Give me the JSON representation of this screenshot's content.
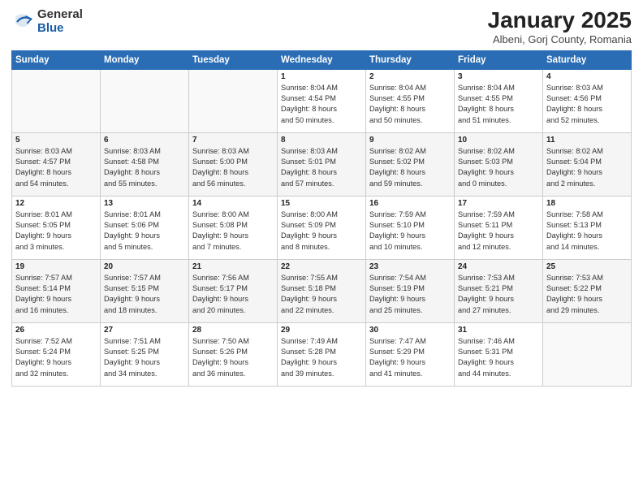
{
  "logo": {
    "general": "General",
    "blue": "Blue"
  },
  "header": {
    "month": "January 2025",
    "location": "Albeni, Gorj County, Romania"
  },
  "weekdays": [
    "Sunday",
    "Monday",
    "Tuesday",
    "Wednesday",
    "Thursday",
    "Friday",
    "Saturday"
  ],
  "weeks": [
    [
      {
        "day": "",
        "info": ""
      },
      {
        "day": "",
        "info": ""
      },
      {
        "day": "",
        "info": ""
      },
      {
        "day": "1",
        "info": "Sunrise: 8:04 AM\nSunset: 4:54 PM\nDaylight: 8 hours\nand 50 minutes."
      },
      {
        "day": "2",
        "info": "Sunrise: 8:04 AM\nSunset: 4:55 PM\nDaylight: 8 hours\nand 50 minutes."
      },
      {
        "day": "3",
        "info": "Sunrise: 8:04 AM\nSunset: 4:55 PM\nDaylight: 8 hours\nand 51 minutes."
      },
      {
        "day": "4",
        "info": "Sunrise: 8:03 AM\nSunset: 4:56 PM\nDaylight: 8 hours\nand 52 minutes."
      }
    ],
    [
      {
        "day": "5",
        "info": "Sunrise: 8:03 AM\nSunset: 4:57 PM\nDaylight: 8 hours\nand 54 minutes."
      },
      {
        "day": "6",
        "info": "Sunrise: 8:03 AM\nSunset: 4:58 PM\nDaylight: 8 hours\nand 55 minutes."
      },
      {
        "day": "7",
        "info": "Sunrise: 8:03 AM\nSunset: 5:00 PM\nDaylight: 8 hours\nand 56 minutes."
      },
      {
        "day": "8",
        "info": "Sunrise: 8:03 AM\nSunset: 5:01 PM\nDaylight: 8 hours\nand 57 minutes."
      },
      {
        "day": "9",
        "info": "Sunrise: 8:02 AM\nSunset: 5:02 PM\nDaylight: 8 hours\nand 59 minutes."
      },
      {
        "day": "10",
        "info": "Sunrise: 8:02 AM\nSunset: 5:03 PM\nDaylight: 9 hours\nand 0 minutes."
      },
      {
        "day": "11",
        "info": "Sunrise: 8:02 AM\nSunset: 5:04 PM\nDaylight: 9 hours\nand 2 minutes."
      }
    ],
    [
      {
        "day": "12",
        "info": "Sunrise: 8:01 AM\nSunset: 5:05 PM\nDaylight: 9 hours\nand 3 minutes."
      },
      {
        "day": "13",
        "info": "Sunrise: 8:01 AM\nSunset: 5:06 PM\nDaylight: 9 hours\nand 5 minutes."
      },
      {
        "day": "14",
        "info": "Sunrise: 8:00 AM\nSunset: 5:08 PM\nDaylight: 9 hours\nand 7 minutes."
      },
      {
        "day": "15",
        "info": "Sunrise: 8:00 AM\nSunset: 5:09 PM\nDaylight: 9 hours\nand 8 minutes."
      },
      {
        "day": "16",
        "info": "Sunrise: 7:59 AM\nSunset: 5:10 PM\nDaylight: 9 hours\nand 10 minutes."
      },
      {
        "day": "17",
        "info": "Sunrise: 7:59 AM\nSunset: 5:11 PM\nDaylight: 9 hours\nand 12 minutes."
      },
      {
        "day": "18",
        "info": "Sunrise: 7:58 AM\nSunset: 5:13 PM\nDaylight: 9 hours\nand 14 minutes."
      }
    ],
    [
      {
        "day": "19",
        "info": "Sunrise: 7:57 AM\nSunset: 5:14 PM\nDaylight: 9 hours\nand 16 minutes."
      },
      {
        "day": "20",
        "info": "Sunrise: 7:57 AM\nSunset: 5:15 PM\nDaylight: 9 hours\nand 18 minutes."
      },
      {
        "day": "21",
        "info": "Sunrise: 7:56 AM\nSunset: 5:17 PM\nDaylight: 9 hours\nand 20 minutes."
      },
      {
        "day": "22",
        "info": "Sunrise: 7:55 AM\nSunset: 5:18 PM\nDaylight: 9 hours\nand 22 minutes."
      },
      {
        "day": "23",
        "info": "Sunrise: 7:54 AM\nSunset: 5:19 PM\nDaylight: 9 hours\nand 25 minutes."
      },
      {
        "day": "24",
        "info": "Sunrise: 7:53 AM\nSunset: 5:21 PM\nDaylight: 9 hours\nand 27 minutes."
      },
      {
        "day": "25",
        "info": "Sunrise: 7:53 AM\nSunset: 5:22 PM\nDaylight: 9 hours\nand 29 minutes."
      }
    ],
    [
      {
        "day": "26",
        "info": "Sunrise: 7:52 AM\nSunset: 5:24 PM\nDaylight: 9 hours\nand 32 minutes."
      },
      {
        "day": "27",
        "info": "Sunrise: 7:51 AM\nSunset: 5:25 PM\nDaylight: 9 hours\nand 34 minutes."
      },
      {
        "day": "28",
        "info": "Sunrise: 7:50 AM\nSunset: 5:26 PM\nDaylight: 9 hours\nand 36 minutes."
      },
      {
        "day": "29",
        "info": "Sunrise: 7:49 AM\nSunset: 5:28 PM\nDaylight: 9 hours\nand 39 minutes."
      },
      {
        "day": "30",
        "info": "Sunrise: 7:47 AM\nSunset: 5:29 PM\nDaylight: 9 hours\nand 41 minutes."
      },
      {
        "day": "31",
        "info": "Sunrise: 7:46 AM\nSunset: 5:31 PM\nDaylight: 9 hours\nand 44 minutes."
      },
      {
        "day": "",
        "info": ""
      }
    ]
  ]
}
